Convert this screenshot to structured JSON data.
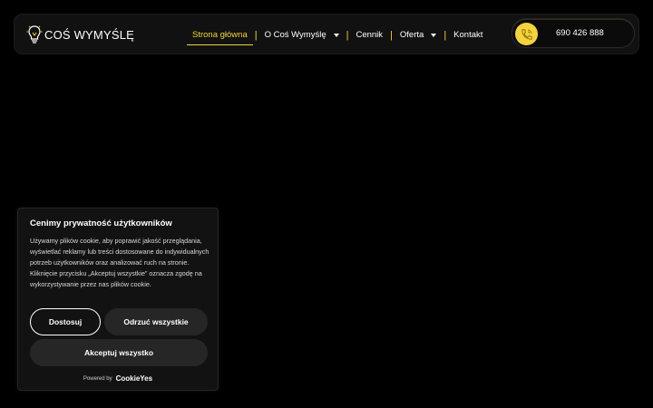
{
  "header": {
    "logo_text": "COŚ WYMYŚLĘ",
    "nav": [
      {
        "label": "Strona główna",
        "active": true
      },
      {
        "label": "O Coś Wymyślę",
        "dropdown": true
      },
      {
        "label": "Cennik"
      },
      {
        "label": "Oferta",
        "dropdown": true
      },
      {
        "label": "Kontakt"
      }
    ],
    "separator": "|",
    "phone": "690 426 888",
    "phone_icon": "phone-icon",
    "accent_color": "#f3d33f"
  },
  "cookie_banner": {
    "title": "Cenimy prywatność użytkowników",
    "text": "Używamy plików cookie, aby poprawić jakość przeglądania, wyświetlać reklamy lub treści dostosowane do indywidualnych potrzeb użytkowników oraz analizować ruch na stronie. Kliknięcie przycisku „Akceptuj wszystkie” oznacza zgodę na wykorzystywanie przez nas plików cookie.",
    "customize_label": "Dostosuj",
    "reject_label": "Odrzuć wszystkie",
    "accept_label": "Akceptuj wszystko",
    "powered_by": "Powered by",
    "powered_brand": "CookieYes"
  }
}
